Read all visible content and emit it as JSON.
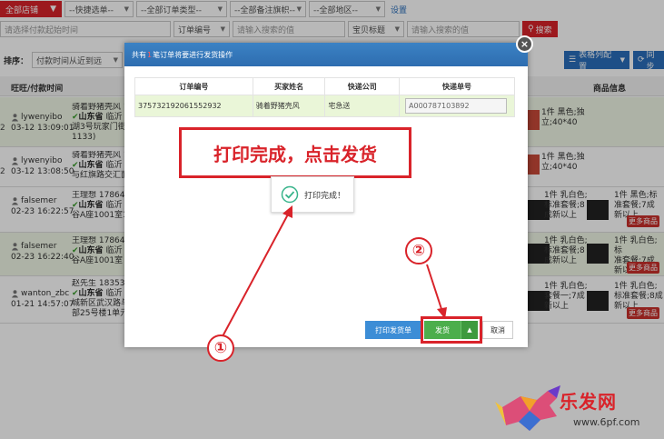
{
  "topbar": {
    "store_label": "全部店铺",
    "selects": [
      "--快捷选单--",
      "--全部订单类型--",
      "--全部备注旗帜--",
      "--全部地区--"
    ],
    "settings_link": "设置"
  },
  "searchrow": {
    "range_placeholder": "请选择付款起始时间",
    "field1_label": "订单编号",
    "field1_placeholder": "请输入搜索的值",
    "field2_label": "宝贝标题",
    "field2_placeholder": "请输入搜索的值",
    "search_label": "搜索"
  },
  "sortbar": {
    "label": "排序：",
    "value": "付款时间从近到远",
    "column_config": "表格列配置",
    "sync": "同步"
  },
  "table": {
    "col_wangwang": "旺旺/付款时间",
    "col_goods": "商品信息",
    "rows": [
      {
        "user": "lywenyibo",
        "time": "03-12 13:09:01",
        "buyer": "骑着野猪壳风 18",
        "prov": "山东省",
        "addr1": "临沂",
        "addr2": "湖3号玩家门街",
        "addr3": "1133)",
        "side": "2",
        "g1": "1件 黑色;独",
        "g2": "立;40*40",
        "hl": true
      },
      {
        "user": "lywenyibo",
        "time": "03-12 13:08:50",
        "buyer": "骑着野猪壳风 18",
        "prov": "山东省",
        "addr1": "临沂",
        "addr2": "与红旗路交汇面",
        "addr3": "",
        "side": "2",
        "g1": "1件 黑色;独",
        "g2": "立;40*40",
        "hl": false
      },
      {
        "user": "falsemer",
        "time": "02-23 16:22:57",
        "buyer": "王理想 17864668",
        "prov": "山东省",
        "addr1": "临沂",
        "addr2": "谷A座1001室11",
        "addr3": "",
        "side": "",
        "g1": "1件 乳白色;",
        "g2": "标准套餐;8",
        "g3": "成新以上",
        "g4": "1件 黑色;标",
        "g5": "准套餐;7成",
        "g6": "新以上",
        "hl": false
      },
      {
        "user": "falsemer",
        "time": "02-23 16:22:40",
        "buyer": "王理想 17864668",
        "prov": "山东省",
        "addr1": "临沂",
        "addr2": "谷A座1001室",
        "addr3": "",
        "side": "",
        "g1": "1件 乳白色;",
        "g2": "标准套餐;8",
        "g3": "成新以上",
        "g4": "1件 乳白色;标",
        "g5": "准套餐;7成",
        "g6": "新以上",
        "hl": true
      },
      {
        "user": "wanton_zbc",
        "time": "01-21 14:57:07",
        "buyer": "赵先生 18353920",
        "prov": "山东省",
        "addr1": "临沂",
        "addr2": "城新区武汉路与",
        "addr3": "部25号楼1单元",
        "side": "",
        "g1": "1件 乳白色;",
        "g2": "套餐一;7成",
        "g3": "新以上",
        "g4": "1件 乳白色;",
        "g5": "标准套餐;8成",
        "g6": "新以上",
        "hl": false
      }
    ],
    "more_goods": "更多商品"
  },
  "modal": {
    "header_prefix": "共有",
    "header_count": "1",
    "header_suffix": "笔订单将要进行发货操作",
    "cols": [
      "订单编号",
      "买家姓名",
      "快递公司",
      "快递单号"
    ],
    "order_no": "375732192061552932",
    "buyer_name": "骑着野猪壳风",
    "express": "宅急送",
    "tracking_no": "A000787103892",
    "annotation": "打印完成，点击发货",
    "toast": "打印完成！",
    "print_btn": "打印发货单",
    "ship_btn": "发货",
    "ship_caret": "▲",
    "cancel_btn": "取消",
    "close": "×",
    "step1": "①",
    "step2": "②"
  },
  "watermark": {
    "name": "乐发网",
    "url": "www.6pf.com"
  },
  "colors": {
    "accent_red": "#d9232a",
    "header_blue": "#2e6db0",
    "ship_green": "#4cae4c"
  }
}
